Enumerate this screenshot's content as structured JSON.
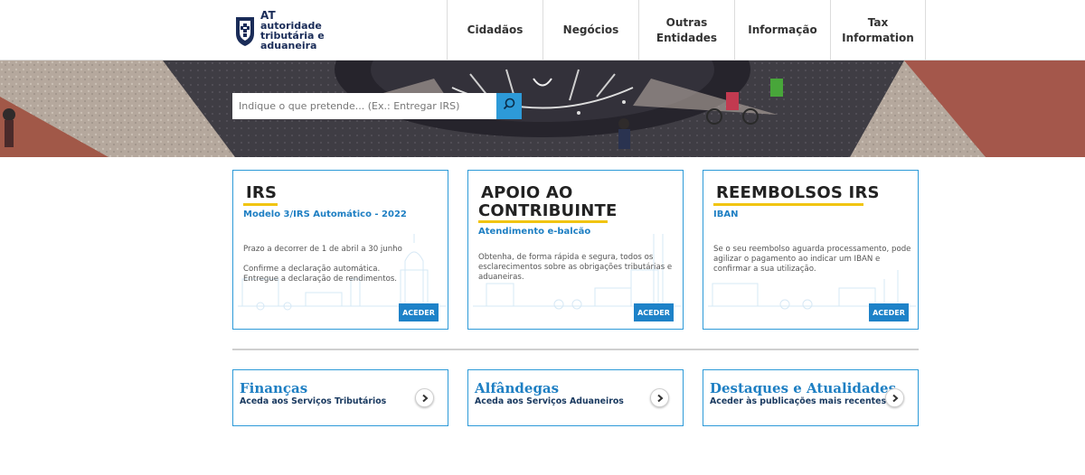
{
  "brand": {
    "line1": "AT",
    "line2": "autoridade",
    "line3": "tributária e aduaneira"
  },
  "nav": {
    "items": [
      {
        "label": "Cidadãos"
      },
      {
        "label": "Negócios"
      },
      {
        "label": "Outras\nEntidades"
      },
      {
        "label": "Informação"
      },
      {
        "label": "Tax\nInformation"
      }
    ]
  },
  "search": {
    "placeholder": "Indique o que pretende... (Ex.: Entregar IRS)",
    "icon": "search-icon"
  },
  "cards": [
    {
      "title": "IRS",
      "subtitle": "Modelo 3/IRS Automático - 2022",
      "text1": "Prazo a decorrer de 1 de abril a 30 junho",
      "text2": "Confirme a declaração automática.\nEntregue a declaração de rendimentos.",
      "button": "ACEDER"
    },
    {
      "title_line1": "APOIO AO",
      "title_line2": "CONTRIBUINTE",
      "subtitle": "Atendimento e-balcão",
      "text1": "Obtenha, de forma rápida e segura, todos os\nesclarecimentos sobre as obrigações tributárias e\naduaneiras.",
      "button": "ACEDER"
    },
    {
      "title": "REEMBOLSOS IRS",
      "subtitle": "IBAN",
      "text1": "Se o seu reembolso aguarda processamento, pode\nagilizar o pagamento ao indicar um IBAN e\nconfirmar a sua utilização.",
      "button": "ACEDER"
    }
  ],
  "links": [
    {
      "title": "Finanças",
      "subtitle": "Aceda aos Serviços Tributários",
      "icon": "chevron-right-icon"
    },
    {
      "title": "Alfândegas",
      "subtitle": "Aceda aos Serviços Aduaneiros",
      "icon": "chevron-right-icon"
    },
    {
      "title": "Destaques e Atualidades",
      "subtitle": "Aceder às publicações mais recentes",
      "icon": "chevron-right-icon"
    }
  ],
  "colors": {
    "accent": "#2d9ad8",
    "button": "#1e82c8",
    "underline": "#f1c40f",
    "brand_navy": "#1a2c58"
  }
}
